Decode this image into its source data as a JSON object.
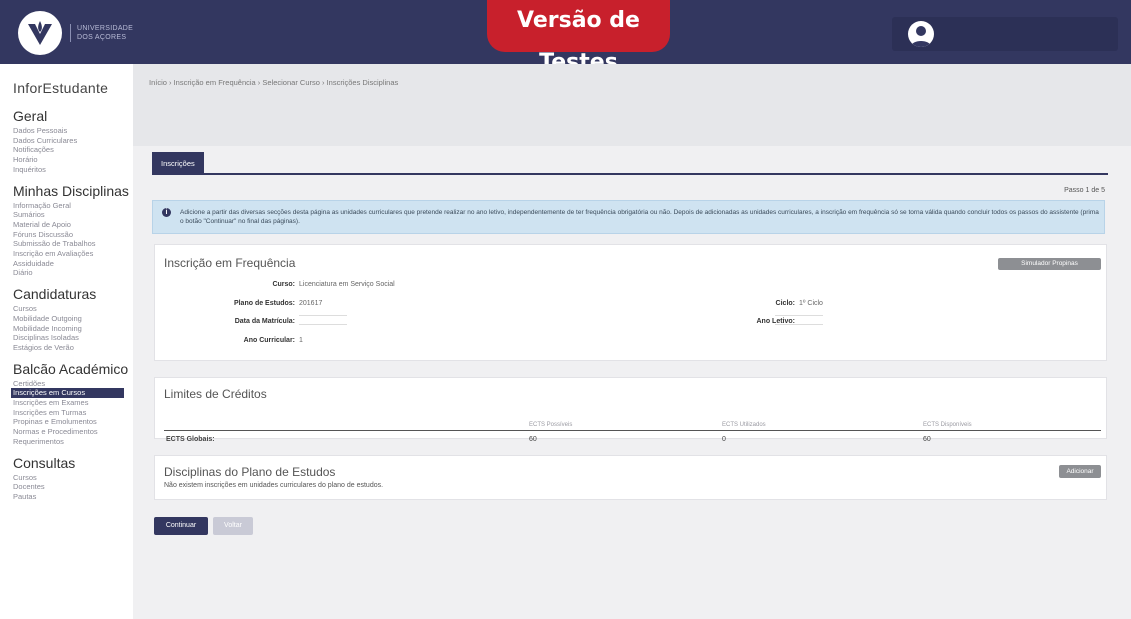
{
  "header": {
    "logo_text_line1": "UNIVERSIDADE",
    "logo_text_line2": "DOS AÇORES",
    "test_banner": "Versão de Testes"
  },
  "sidebar": {
    "app_title": "InforEstudante",
    "sections": [
      {
        "title": "Geral",
        "items": [
          "Dados Pessoais",
          "Dados Curriculares",
          "Notificações",
          "Horário",
          "Inquéritos"
        ]
      },
      {
        "title": "Minhas Disciplinas",
        "items": [
          "Informação Geral",
          "Sumários",
          "Material de Apoio",
          "Fóruns Discussão",
          "Submissão de Trabalhos",
          "Inscrição em Avaliações",
          "Assiduidade",
          "Diário"
        ]
      },
      {
        "title": "Candidaturas",
        "items": [
          "Cursos",
          "Mobilidade Outgoing",
          "Mobilidade Incoming",
          "Disciplinas Isoladas",
          "Estágios de Verão"
        ]
      },
      {
        "title": "Balcão Académico",
        "items": [
          "Certidões",
          "Inscrições em Cursos",
          "Inscrições em Exames",
          "Inscrições em Turmas",
          "Propinas e Emolumentos",
          "Normas e Procedimentos",
          "Requerimentos"
        ],
        "active_index": 1
      },
      {
        "title": "Consultas",
        "items": [
          "Cursos",
          "Docentes",
          "Pautas"
        ]
      }
    ]
  },
  "main": {
    "breadcrumb": "Início  ›  Inscrição em Frequência  ›  Selecionar Curso  ›  Inscrições Disciplinas",
    "tab_label": "Inscrições",
    "step": "Passo 1 de 5",
    "alert_text": "Adicione a partir das diversas secções desta página as unidades curriculares que pretende realizar no ano letivo, independentemente de ter frequência obrigatória ou não. Depois de adicionadas as unidades curriculares, a inscrição em frequência só se torna válida quando concluir todos os passos do assistente (prima o botão \"Continuar\" no final das páginas).",
    "enrollment": {
      "title": "Inscrição em Frequência",
      "simulator_button": "Simulador Propinas",
      "course_label": "Curso:",
      "course_value": "Licenciatura em Serviço Social",
      "plan_label": "Plano de Estudos:",
      "plan_value": "201617",
      "cycle_label": "Ciclo:",
      "cycle_value": "1º Ciclo",
      "enroll_date_label": "Data da Matrícula:",
      "year_label": "Ano Letivo:",
      "curricular_year_label": "Ano Curricular:",
      "curricular_year_value": "1"
    },
    "credits": {
      "title": "Limites de Créditos",
      "headers": [
        "ECTS Possíveis",
        "ECTS Utilizados",
        "ECTS Disponíveis"
      ],
      "row_label": "ECTS Globais:",
      "row_values": [
        "60",
        "0",
        "60"
      ]
    },
    "plan": {
      "title": "Disciplinas do Plano de Estudos",
      "add_button": "Adicionar",
      "empty_text": "Não existem inscrições em unidades curriculares do plano de estudos."
    },
    "continue_button": "Continuar",
    "back_button": "Voltar"
  }
}
